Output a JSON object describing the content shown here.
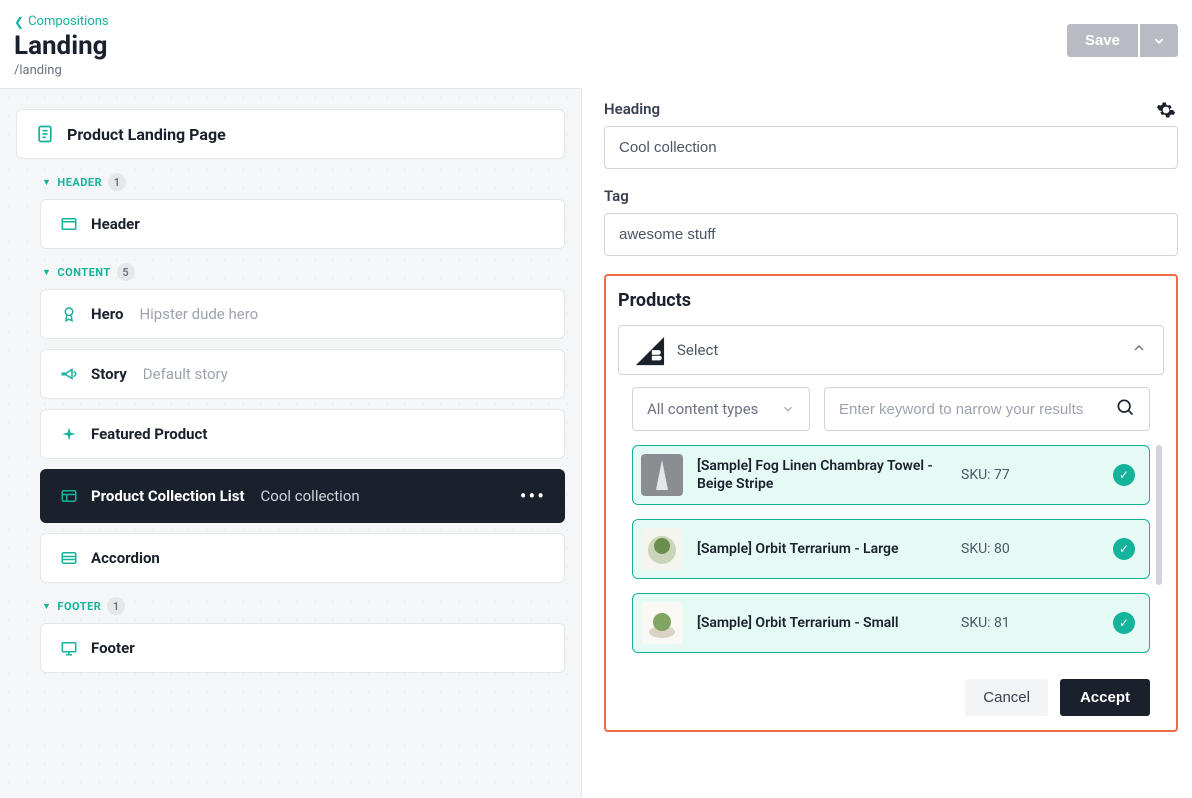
{
  "breadcrumb": {
    "label": "Compositions"
  },
  "page": {
    "title": "Landing",
    "slug": "/landing"
  },
  "actions": {
    "save": "Save"
  },
  "tree": {
    "root": {
      "label": "Product Landing Page"
    },
    "sections": [
      {
        "name": "HEADER",
        "count": "1",
        "items": [
          {
            "key": "header",
            "title": "Header",
            "subtitle": ""
          }
        ]
      },
      {
        "name": "CONTENT",
        "count": "5",
        "items": [
          {
            "key": "hero",
            "title": "Hero",
            "subtitle": "Hipster dude hero"
          },
          {
            "key": "story",
            "title": "Story",
            "subtitle": "Default story"
          },
          {
            "key": "featured",
            "title": "Featured Product",
            "subtitle": ""
          },
          {
            "key": "collection",
            "title": "Product Collection List",
            "subtitle": "Cool collection",
            "active": true
          },
          {
            "key": "accordion",
            "title": "Accordion",
            "subtitle": ""
          }
        ]
      },
      {
        "name": "FOOTER",
        "count": "1",
        "items": [
          {
            "key": "footer",
            "title": "Footer",
            "subtitle": ""
          }
        ]
      }
    ]
  },
  "editor": {
    "heading": {
      "label": "Heading",
      "value": "Cool collection"
    },
    "tag": {
      "label": "Tag",
      "value": "awesome stuff"
    },
    "products": {
      "title": "Products",
      "select_label": "Select",
      "filter_label": "All content types",
      "search_placeholder": "Enter keyword to narrow your results",
      "sku_prefix": "SKU: ",
      "items": [
        {
          "name": "[Sample] Fog Linen Chambray Towel - Beige Stripe",
          "sku": "77"
        },
        {
          "name": "[Sample] Orbit Terrarium - Large",
          "sku": "80"
        },
        {
          "name": "[Sample] Orbit Terrarium - Small",
          "sku": "81"
        }
      ],
      "cancel": "Cancel",
      "accept": "Accept"
    }
  }
}
